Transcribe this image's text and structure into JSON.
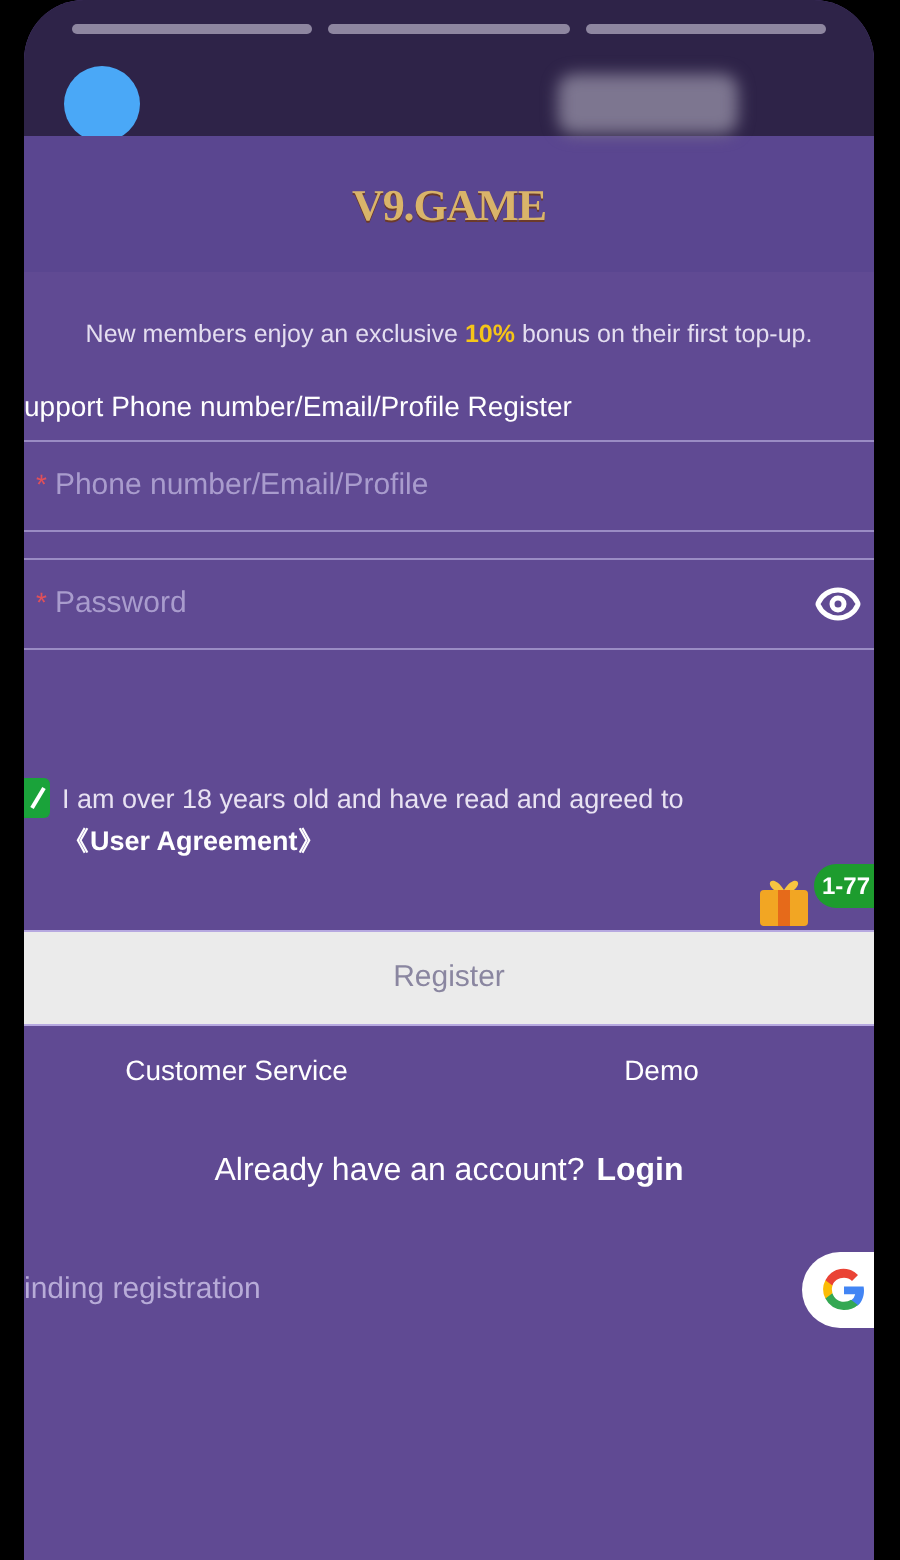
{
  "logo": {
    "text": "V9.GAME"
  },
  "promo": {
    "before": "New members enjoy an exclusive ",
    "highlight": "10%",
    "after": " bonus on their first top-up."
  },
  "support_title": "upport Phone number/Email/Profile Register",
  "fields": [
    {
      "kind": "text",
      "required_mark": "*",
      "placeholder": "Phone number/Email/Profile"
    },
    {
      "kind": "password",
      "required_mark": "*",
      "placeholder": "Password"
    }
  ],
  "agreement": {
    "checked": true,
    "text": "I am over 18 years old and have read and agreed to ",
    "link": "《User Agreement》"
  },
  "gift_badge": "1-77",
  "register_button": "Register",
  "links": [
    "Customer Service",
    "Demo"
  ],
  "login_prompt": {
    "text": "Already have an account?",
    "link": "Login"
  },
  "binding": {
    "label": "inding registration"
  }
}
